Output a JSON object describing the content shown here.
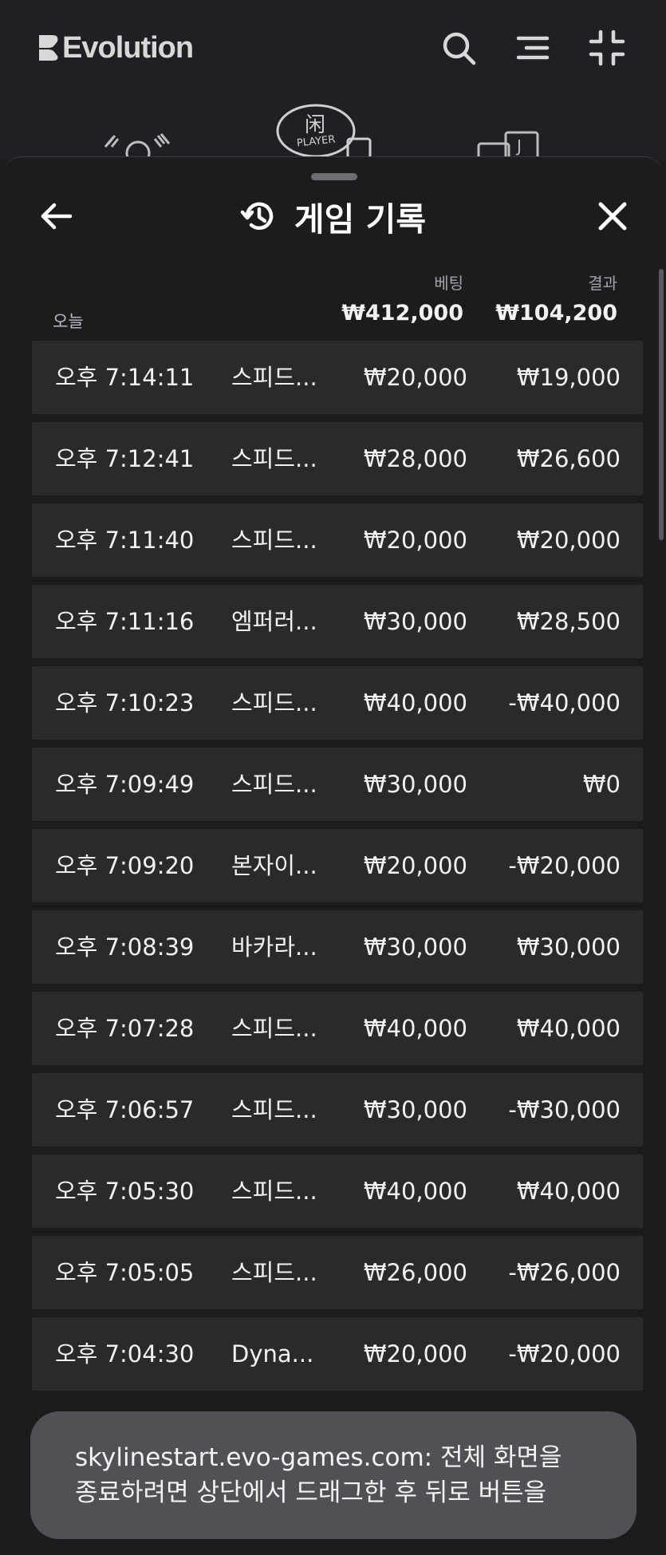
{
  "brand": {
    "name": "Evolution"
  },
  "deco": {
    "player_glyph": "闲",
    "player_label": "PLAYER"
  },
  "sheet": {
    "title": "게임 기록",
    "columns": {
      "bet": "베팅",
      "result": "결과"
    },
    "today": {
      "label": "오늘",
      "total_bet": "₩412,000",
      "total_result": "₩104,200"
    },
    "rows": [
      {
        "time": "오후 7:14:11",
        "game": "스피드...",
        "bet": "₩20,000",
        "result": "₩19,000"
      },
      {
        "time": "오후 7:12:41",
        "game": "스피드...",
        "bet": "₩28,000",
        "result": "₩26,600"
      },
      {
        "time": "오후 7:11:40",
        "game": "스피드...",
        "bet": "₩20,000",
        "result": "₩20,000"
      },
      {
        "time": "오후 7:11:16",
        "game": "엠퍼러...",
        "bet": "₩30,000",
        "result": "₩28,500"
      },
      {
        "time": "오후 7:10:23",
        "game": "스피드...",
        "bet": "₩40,000",
        "result": "-₩40,000"
      },
      {
        "time": "오후 7:09:49",
        "game": "스피드...",
        "bet": "₩30,000",
        "result": "₩0"
      },
      {
        "time": "오후 7:09:20",
        "game": "본자이...",
        "bet": "₩20,000",
        "result": "-₩20,000"
      },
      {
        "time": "오후 7:08:39",
        "game": "바카라...",
        "bet": "₩30,000",
        "result": "₩30,000"
      },
      {
        "time": "오후 7:07:28",
        "game": "스피드...",
        "bet": "₩40,000",
        "result": "₩40,000"
      },
      {
        "time": "오후 7:06:57",
        "game": "스피드...",
        "bet": "₩30,000",
        "result": "-₩30,000"
      },
      {
        "time": "오후 7:05:30",
        "game": "스피드...",
        "bet": "₩40,000",
        "result": "₩40,000"
      },
      {
        "time": "오후 7:05:05",
        "game": "스피드...",
        "bet": "₩26,000",
        "result": "-₩26,000"
      },
      {
        "time": "오후 7:04:30",
        "game": "Dyna...",
        "bet": "₩20,000",
        "result": "-₩20,000"
      }
    ]
  },
  "toast": {
    "line1": "skylinestart.evo-games.com: 전체 화면을",
    "line2": "종료하려면 상단에서 드래그한 후 뒤로 버튼을"
  }
}
